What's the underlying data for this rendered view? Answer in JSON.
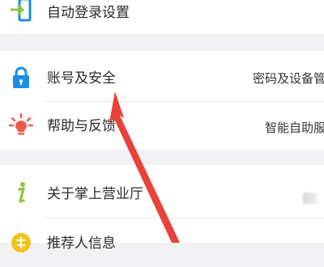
{
  "rows": {
    "auto_login": {
      "label": "自动登录设置",
      "icon": "login-arrow-icon"
    },
    "account_security": {
      "label": "账号及安全",
      "value": "密码及设备管",
      "icon": "lock-icon"
    },
    "help_feedback": {
      "label": "帮助与反馈",
      "value": "智能自助服",
      "icon": "lightbulb-icon"
    },
    "about": {
      "label": "关于掌上营业厅",
      "icon": "info-i-icon"
    },
    "recommender": {
      "label": "推荐人信息",
      "icon": "recommend-badge-icon"
    }
  },
  "colors": {
    "accent_blue": "#1c8de6",
    "accent_red": "#ef5a4c",
    "accent_green": "#8cc63f",
    "accent_yellow": "#f2c21b",
    "annotation_arrow": "#e8423a"
  }
}
